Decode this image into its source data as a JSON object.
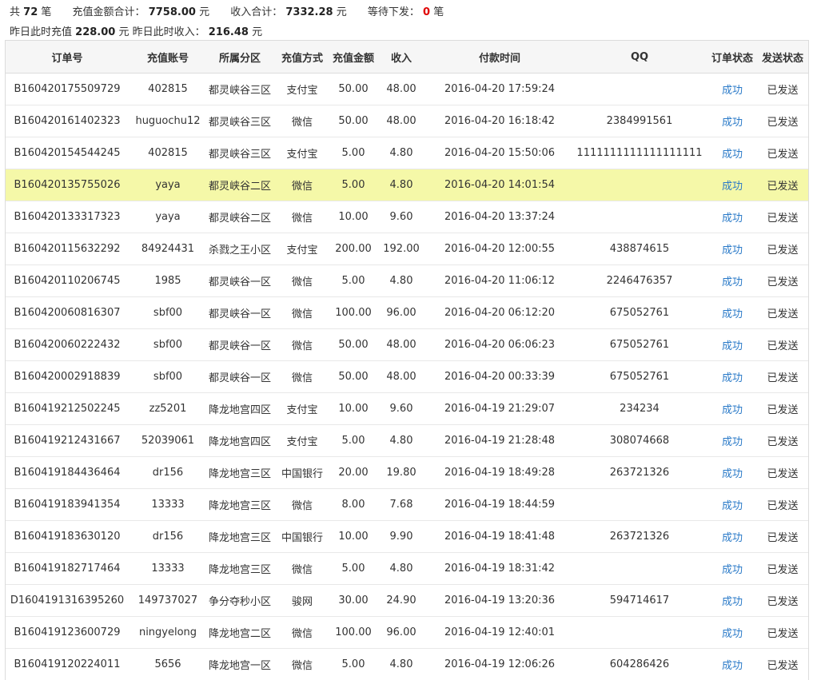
{
  "summary": {
    "count_prefix": "共",
    "count": "72",
    "count_unit": "笔",
    "recharge_total_label": "充值金额合计：",
    "recharge_total": "7758.00",
    "recharge_total_unit": "元",
    "income_total_label": "收入合计：",
    "income_total": "7332.28",
    "income_total_unit": "元",
    "pending_label": "等待下发：",
    "pending": "0",
    "pending_unit": "笔",
    "yesterday_recharge_label": "昨日此时充值",
    "yesterday_recharge": "228.00",
    "yesterday_recharge_unit": "元",
    "yesterday_income_label": "昨日此时收入：",
    "yesterday_income": "216.48",
    "yesterday_income_unit": "元"
  },
  "table": {
    "headers": [
      "订单号",
      "充值账号",
      "所属分区",
      "充值方式",
      "充值金额",
      "收入",
      "付款时间",
      "QQ",
      "订单状态",
      "发送状态"
    ],
    "rows": [
      {
        "order": "B160420175509729",
        "account": "402815",
        "zone": "都灵峡谷三区",
        "method": "支付宝",
        "amount": "50.00",
        "income": "48.00",
        "time": "2016-04-20 17:59:24",
        "qq": "",
        "status": "成功",
        "send": "已发送"
      },
      {
        "order": "B160420161402323",
        "account": "huguochu12",
        "zone": "都灵峡谷三区",
        "method": "微信",
        "amount": "50.00",
        "income": "48.00",
        "time": "2016-04-20 16:18:42",
        "qq": "2384991561",
        "status": "成功",
        "send": "已发送"
      },
      {
        "order": "B160420154544245",
        "account": "402815",
        "zone": "都灵峡谷三区",
        "method": "支付宝",
        "amount": "5.00",
        "income": "4.80",
        "time": "2016-04-20 15:50:06",
        "qq": "1111111111111111111",
        "status": "成功",
        "send": "已发送"
      },
      {
        "order": "B160420135755026",
        "account": "yaya",
        "zone": "都灵峡谷二区",
        "method": "微信",
        "amount": "5.00",
        "income": "4.80",
        "time": "2016-04-20 14:01:54",
        "qq": "",
        "status": "成功",
        "send": "已发送",
        "highlight": true
      },
      {
        "order": "B160420133317323",
        "account": "yaya",
        "zone": "都灵峡谷二区",
        "method": "微信",
        "amount": "10.00",
        "income": "9.60",
        "time": "2016-04-20 13:37:24",
        "qq": "",
        "status": "成功",
        "send": "已发送"
      },
      {
        "order": "B160420115632292",
        "account": "84924431",
        "zone": "杀戮之王小区",
        "method": "支付宝",
        "amount": "200.00",
        "income": "192.00",
        "time": "2016-04-20 12:00:55",
        "qq": "438874615",
        "status": "成功",
        "send": "已发送"
      },
      {
        "order": "B160420110206745",
        "account": "1985",
        "zone": "都灵峡谷一区",
        "method": "微信",
        "amount": "5.00",
        "income": "4.80",
        "time": "2016-04-20 11:06:12",
        "qq": "2246476357",
        "status": "成功",
        "send": "已发送"
      },
      {
        "order": "B160420060816307",
        "account": "sbf00",
        "zone": "都灵峡谷一区",
        "method": "微信",
        "amount": "100.00",
        "income": "96.00",
        "time": "2016-04-20 06:12:20",
        "qq": "675052761",
        "status": "成功",
        "send": "已发送"
      },
      {
        "order": "B160420060222432",
        "account": "sbf00",
        "zone": "都灵峡谷一区",
        "method": "微信",
        "amount": "50.00",
        "income": "48.00",
        "time": "2016-04-20 06:06:23",
        "qq": "675052761",
        "status": "成功",
        "send": "已发送"
      },
      {
        "order": "B160420002918839",
        "account": "sbf00",
        "zone": "都灵峡谷一区",
        "method": "微信",
        "amount": "50.00",
        "income": "48.00",
        "time": "2016-04-20 00:33:39",
        "qq": "675052761",
        "status": "成功",
        "send": "已发送"
      },
      {
        "order": "B160419212502245",
        "account": "zz5201",
        "zone": "降龙地宫四区",
        "method": "支付宝",
        "amount": "10.00",
        "income": "9.60",
        "time": "2016-04-19 21:29:07",
        "qq": "234234",
        "status": "成功",
        "send": "已发送"
      },
      {
        "order": "B160419212431667",
        "account": "52039061",
        "zone": "降龙地宫四区",
        "method": "支付宝",
        "amount": "5.00",
        "income": "4.80",
        "time": "2016-04-19 21:28:48",
        "qq": "308074668",
        "status": "成功",
        "send": "已发送"
      },
      {
        "order": "B160419184436464",
        "account": "dr156",
        "zone": "降龙地宫三区",
        "method": "中国银行",
        "amount": "20.00",
        "income": "19.80",
        "time": "2016-04-19 18:49:28",
        "qq": "263721326",
        "status": "成功",
        "send": "已发送"
      },
      {
        "order": "B160419183941354",
        "account": "13333",
        "zone": "降龙地宫三区",
        "method": "微信",
        "amount": "8.00",
        "income": "7.68",
        "time": "2016-04-19 18:44:59",
        "qq": "",
        "status": "成功",
        "send": "已发送"
      },
      {
        "order": "B160419183630120",
        "account": "dr156",
        "zone": "降龙地宫三区",
        "method": "中国银行",
        "amount": "10.00",
        "income": "9.90",
        "time": "2016-04-19 18:41:48",
        "qq": "263721326",
        "status": "成功",
        "send": "已发送"
      },
      {
        "order": "B160419182717464",
        "account": "13333",
        "zone": "降龙地宫三区",
        "method": "微信",
        "amount": "5.00",
        "income": "4.80",
        "time": "2016-04-19 18:31:42",
        "qq": "",
        "status": "成功",
        "send": "已发送"
      },
      {
        "order": "D1604191316395260",
        "account": "149737027",
        "zone": "争分夺秒小区",
        "method": "骏网",
        "amount": "30.00",
        "income": "24.90",
        "time": "2016-04-19 13:20:36",
        "qq": "594714617",
        "status": "成功",
        "send": "已发送"
      },
      {
        "order": "B160419123600729",
        "account": "ningyelong",
        "zone": "降龙地宫二区",
        "method": "微信",
        "amount": "100.00",
        "income": "96.00",
        "time": "2016-04-19 12:40:01",
        "qq": "",
        "status": "成功",
        "send": "已发送"
      },
      {
        "order": "B160419120224011",
        "account": "5656",
        "zone": "降龙地宫一区",
        "method": "微信",
        "amount": "5.00",
        "income": "4.80",
        "time": "2016-04-19 12:06:26",
        "qq": "604286426",
        "status": "成功",
        "send": "已发送"
      }
    ]
  },
  "colors": {
    "highlight_row": "#f5f8a8",
    "link": "#2a7ac8",
    "pending_value": "#e00000"
  }
}
